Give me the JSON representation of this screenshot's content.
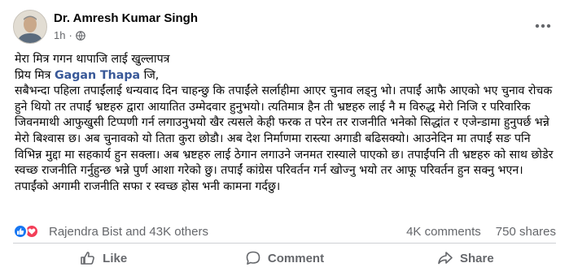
{
  "post": {
    "author": "Dr. Amresh Kumar Singh",
    "timestamp": "1h",
    "privacy_icon": "globe-icon",
    "more_icon": "more-horizontal-icon",
    "lines": {
      "l1": "मेरा मित्र गगन थापाजि लाई खुल्लापत्र",
      "l2_pre": "प्रिय मित्र ",
      "l2_mention": "Gagan Thapa",
      "l2_post": " जि,",
      "l3": "सबैभन्दा पहिला तपाईंलाई धन्यवाद दिन चाहन्छु कि तपाईंले सर्लाहीमा आएर चुनाव लड्नु भो। तपाईं आफै आएको भए चुनाव रोचक हुने थियो तर तपाईं भ्रष्टहरु द्वारा आयातित उम्मेदवार हुनुभयो। त्यतिमात्र हैन ती भ्रष्टहरु लाई नै म विरुद्ध मेरो निजि र परिवारिक जिवनमाथी आफुखुसी टिप्पणी गर्न लगाउनुभयो खैर त्यसले केही फरक त परेन तर राजनीति भनेको सिद्धांत र एजेन्डामा हुनुपर्छ भन्ने मेरो बिश्वास छ। अब चुनावको यो तिता कुरा छोडौ। अब देश निर्माणमा रास्त्या अगाडी बढिसक्यो। आउनेदिन मा तपाईं सङ पनि विभिन्न मुद्दा मा सहकार्य हुन सक्ला। अब भ्रष्टहरु लाई ठेगान लगाउने जनमत रास्याले पाएको छ। तपाईंपनि ती भ्रष्टहरु को साथ छोडेर स्वच्छ राजनीति गर्नुहुन्छ भन्ने पुर्ण आशा गरेको छु। तपाईं कांग्रेस परिवर्तन गर्न खोज्नु भयो तर आफू परिवर्तन हुन सक्नु भएन। तपाईंको अगामी राजनीति सफा र स्वच्छ होस भनी कामना गर्दछु।"
    }
  },
  "reactions": {
    "icons": [
      "like-reaction-icon",
      "love-reaction-icon"
    ],
    "summary": "Rajendra Bist and 43K others",
    "comments": "4K comments",
    "shares": "750 shares"
  },
  "actions": {
    "like": "Like",
    "comment": "Comment",
    "share": "Share"
  },
  "colors": {
    "mention": "#385898",
    "like_blue": "#1877f2",
    "love_red": "#f33e58",
    "secondary_text": "#65676b"
  }
}
